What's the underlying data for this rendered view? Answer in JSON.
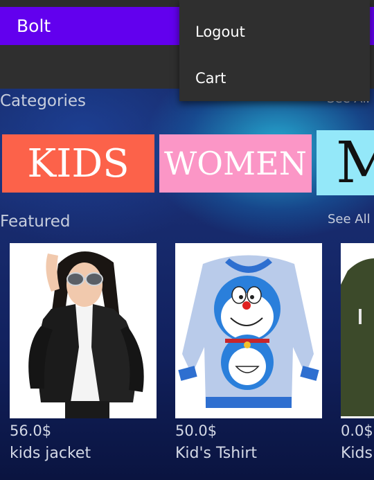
{
  "app": {
    "title": "Bolt"
  },
  "menu": {
    "items": [
      {
        "label": "Logout"
      },
      {
        "label": "Cart"
      }
    ]
  },
  "categories": {
    "title": "Categories",
    "see_all": "See All",
    "items": [
      {
        "label": "KIDS"
      },
      {
        "label": "WOMEN"
      },
      {
        "label": "M"
      }
    ]
  },
  "featured": {
    "title": "Featured",
    "see_all": "See All",
    "products": [
      {
        "price": "56.0$",
        "name": "kids jacket"
      },
      {
        "price": "50.0$",
        "name": "Kid's Tshirt"
      },
      {
        "price": "0.0$",
        "name": "Kids"
      }
    ]
  },
  "colors": {
    "accent": "#6200ee",
    "menu_bg": "#2f2f2f",
    "kids": "#fc624a",
    "women": "#fb96c6",
    "men": "#94e8f9"
  }
}
